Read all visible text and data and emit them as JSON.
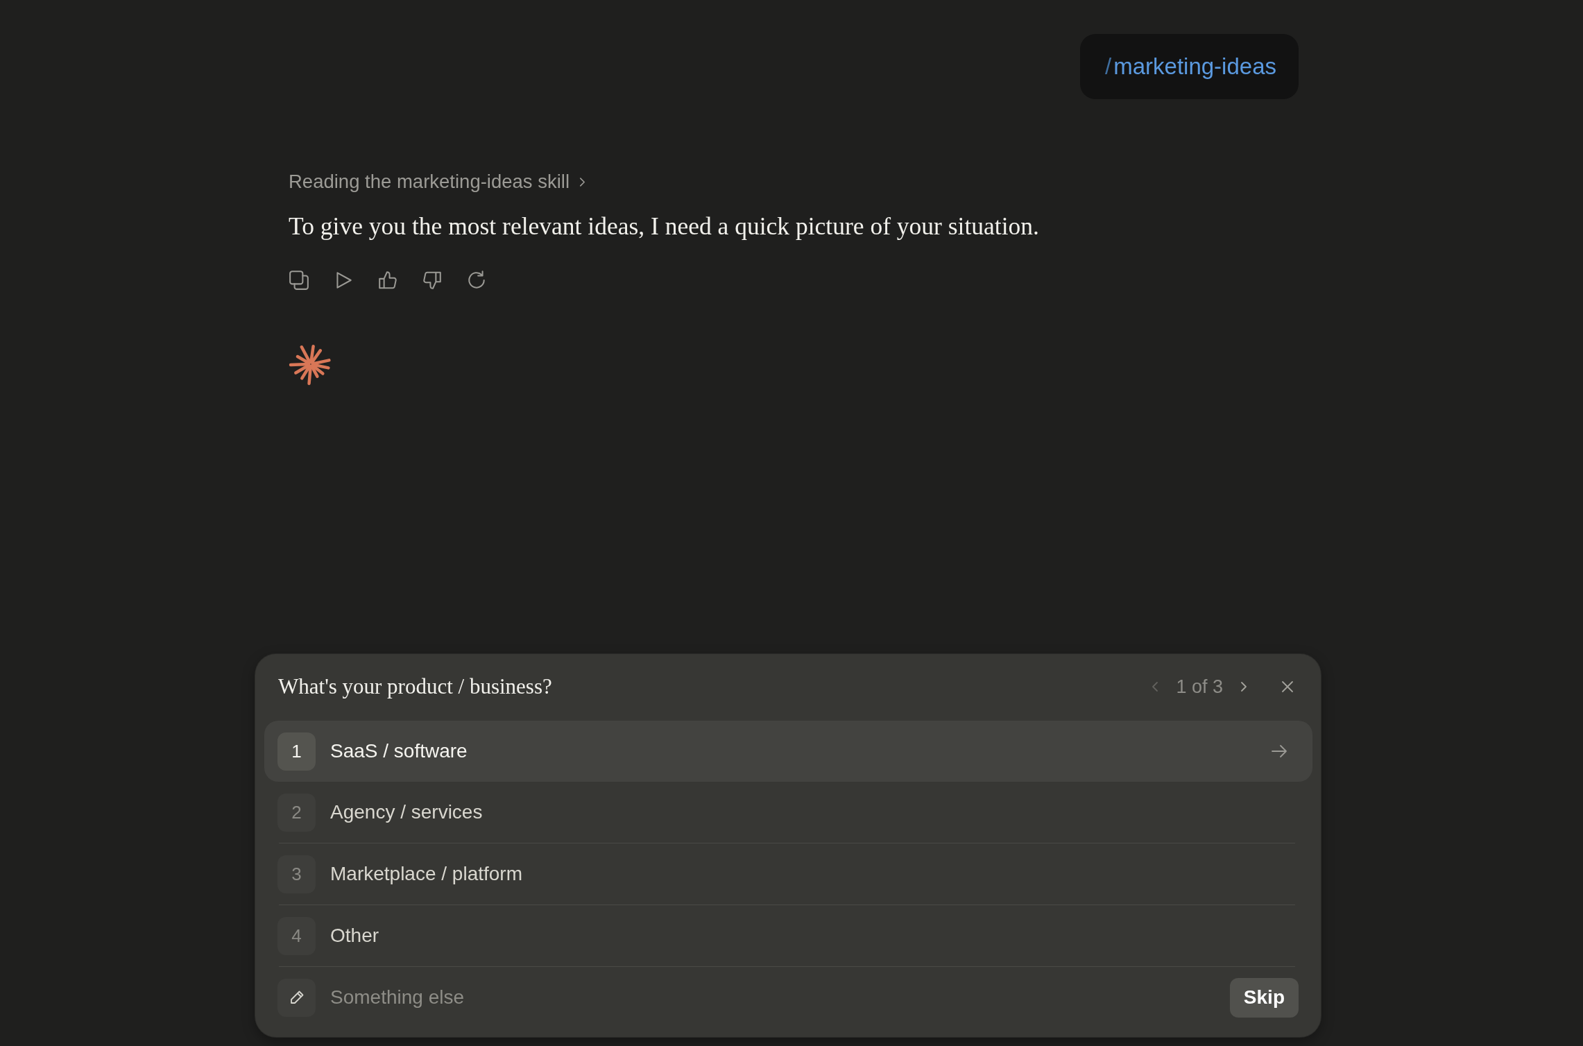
{
  "slash_command": {
    "prefix": "/",
    "name": "marketing-ideas"
  },
  "assistant": {
    "activity": "Reading the marketing-ideas skill",
    "message": "To give you the most relevant ideas, I need a quick picture of your situation."
  },
  "question": {
    "title": "What's your product / business?",
    "pager": {
      "text": "1 of 3",
      "prev_disabled": true,
      "next_disabled": false
    },
    "options": [
      {
        "number": "1",
        "label": "SaaS / software",
        "selected": true
      },
      {
        "number": "2",
        "label": "Agency / services",
        "selected": false
      },
      {
        "number": "3",
        "label": "Marketplace / platform",
        "selected": false
      },
      {
        "number": "4",
        "label": "Other",
        "selected": false
      }
    ],
    "other": {
      "placeholder": "Something else"
    },
    "skip_button": "Skip"
  }
}
